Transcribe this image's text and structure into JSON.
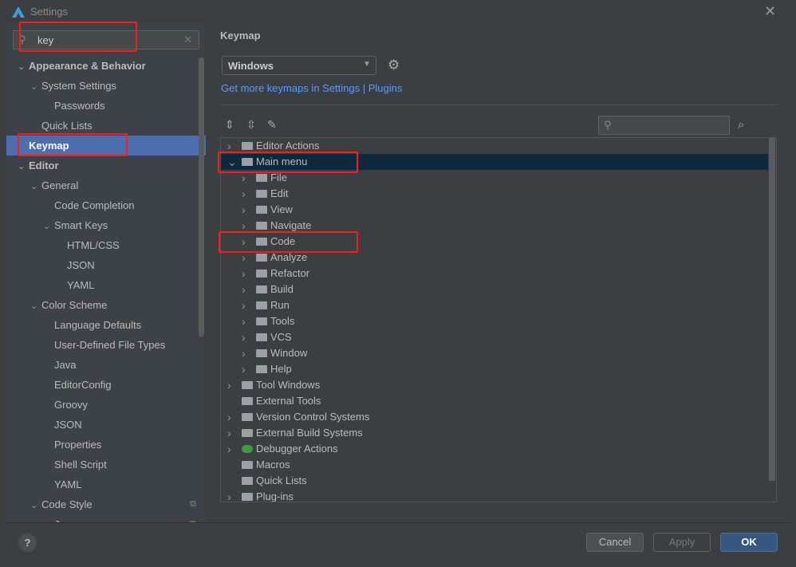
{
  "window": {
    "title": "Settings"
  },
  "search": {
    "value": "key"
  },
  "sidebar": {
    "items": [
      {
        "label": "Appearance & Behavior",
        "level": 0,
        "expanded": true,
        "bold": true
      },
      {
        "label": "System Settings",
        "level": 1,
        "expanded": true
      },
      {
        "label": "Passwords",
        "level": 2
      },
      {
        "label": "Quick Lists",
        "level": 1
      },
      {
        "label": "Keymap",
        "level": 0,
        "bold": true,
        "selected": true
      },
      {
        "label": "Editor",
        "level": 0,
        "expanded": true,
        "bold": true
      },
      {
        "label": "General",
        "level": 1,
        "expanded": true
      },
      {
        "label": "Code Completion",
        "level": 2
      },
      {
        "label": "Smart Keys",
        "level": 2,
        "expanded": true
      },
      {
        "label": "HTML/CSS",
        "level": 3
      },
      {
        "label": "JSON",
        "level": 3
      },
      {
        "label": "YAML",
        "level": 3
      },
      {
        "label": "Color Scheme",
        "level": 1,
        "expanded": true
      },
      {
        "label": "Language Defaults",
        "level": 2
      },
      {
        "label": "User-Defined File Types",
        "level": 2
      },
      {
        "label": "Java",
        "level": 2
      },
      {
        "label": "EditorConfig",
        "level": 2
      },
      {
        "label": "Groovy",
        "level": 2
      },
      {
        "label": "JSON",
        "level": 2
      },
      {
        "label": "Properties",
        "level": 2
      },
      {
        "label": "Shell Script",
        "level": 2
      },
      {
        "label": "YAML",
        "level": 2
      },
      {
        "label": "Code Style",
        "level": 1,
        "expanded": true,
        "copy": true
      },
      {
        "label": "J",
        "level": 2,
        "copy": true
      }
    ]
  },
  "main": {
    "title": "Keymap",
    "keymap_selected": "Windows",
    "link_text": "Get more keymaps in Settings | Plugins",
    "tree": [
      {
        "label": "Editor Actions",
        "level": 0,
        "chevron": "right",
        "icon": "folder"
      },
      {
        "label": "Main menu",
        "level": 0,
        "chevron": "down",
        "icon": "folder",
        "selected": true
      },
      {
        "label": "File",
        "level": 1,
        "chevron": "right",
        "icon": "folder"
      },
      {
        "label": "Edit",
        "level": 1,
        "chevron": "right",
        "icon": "folder"
      },
      {
        "label": "View",
        "level": 1,
        "chevron": "right",
        "icon": "folder"
      },
      {
        "label": "Navigate",
        "level": 1,
        "chevron": "right",
        "icon": "folder"
      },
      {
        "label": "Code",
        "level": 1,
        "chevron": "right",
        "icon": "folder"
      },
      {
        "label": "Analyze",
        "level": 1,
        "chevron": "right",
        "icon": "folder"
      },
      {
        "label": "Refactor",
        "level": 1,
        "chevron": "right",
        "icon": "folder"
      },
      {
        "label": "Build",
        "level": 1,
        "chevron": "right",
        "icon": "folder"
      },
      {
        "label": "Run",
        "level": 1,
        "chevron": "right",
        "icon": "folder"
      },
      {
        "label": "Tools",
        "level": 1,
        "chevron": "right",
        "icon": "folder"
      },
      {
        "label": "VCS",
        "level": 1,
        "chevron": "right",
        "icon": "folder"
      },
      {
        "label": "Window",
        "level": 1,
        "chevron": "right",
        "icon": "folder"
      },
      {
        "label": "Help",
        "level": 1,
        "chevron": "right",
        "icon": "folder"
      },
      {
        "label": "Tool Windows",
        "level": 0,
        "chevron": "right",
        "icon": "folder"
      },
      {
        "label": "External Tools",
        "level": 0,
        "chevron": "",
        "icon": "folder"
      },
      {
        "label": "Version Control Systems",
        "level": 0,
        "chevron": "right",
        "icon": "folder"
      },
      {
        "label": "External Build Systems",
        "level": 0,
        "chevron": "right",
        "icon": "folder"
      },
      {
        "label": "Debugger Actions",
        "level": 0,
        "chevron": "right",
        "icon": "bug"
      },
      {
        "label": "Macros",
        "level": 0,
        "chevron": "",
        "icon": "folder"
      },
      {
        "label": "Quick Lists",
        "level": 0,
        "chevron": "",
        "icon": "folder"
      },
      {
        "label": "Plug-ins",
        "level": 0,
        "chevron": "right",
        "icon": "folder"
      }
    ]
  },
  "buttons": {
    "cancel": "Cancel",
    "apply": "Apply",
    "ok": "OK",
    "help": "?"
  },
  "colors": {
    "selection": "#4b6eaf",
    "tree_selection": "#0d293e",
    "link": "#589df6",
    "highlight_box": "#ff1a1a"
  }
}
